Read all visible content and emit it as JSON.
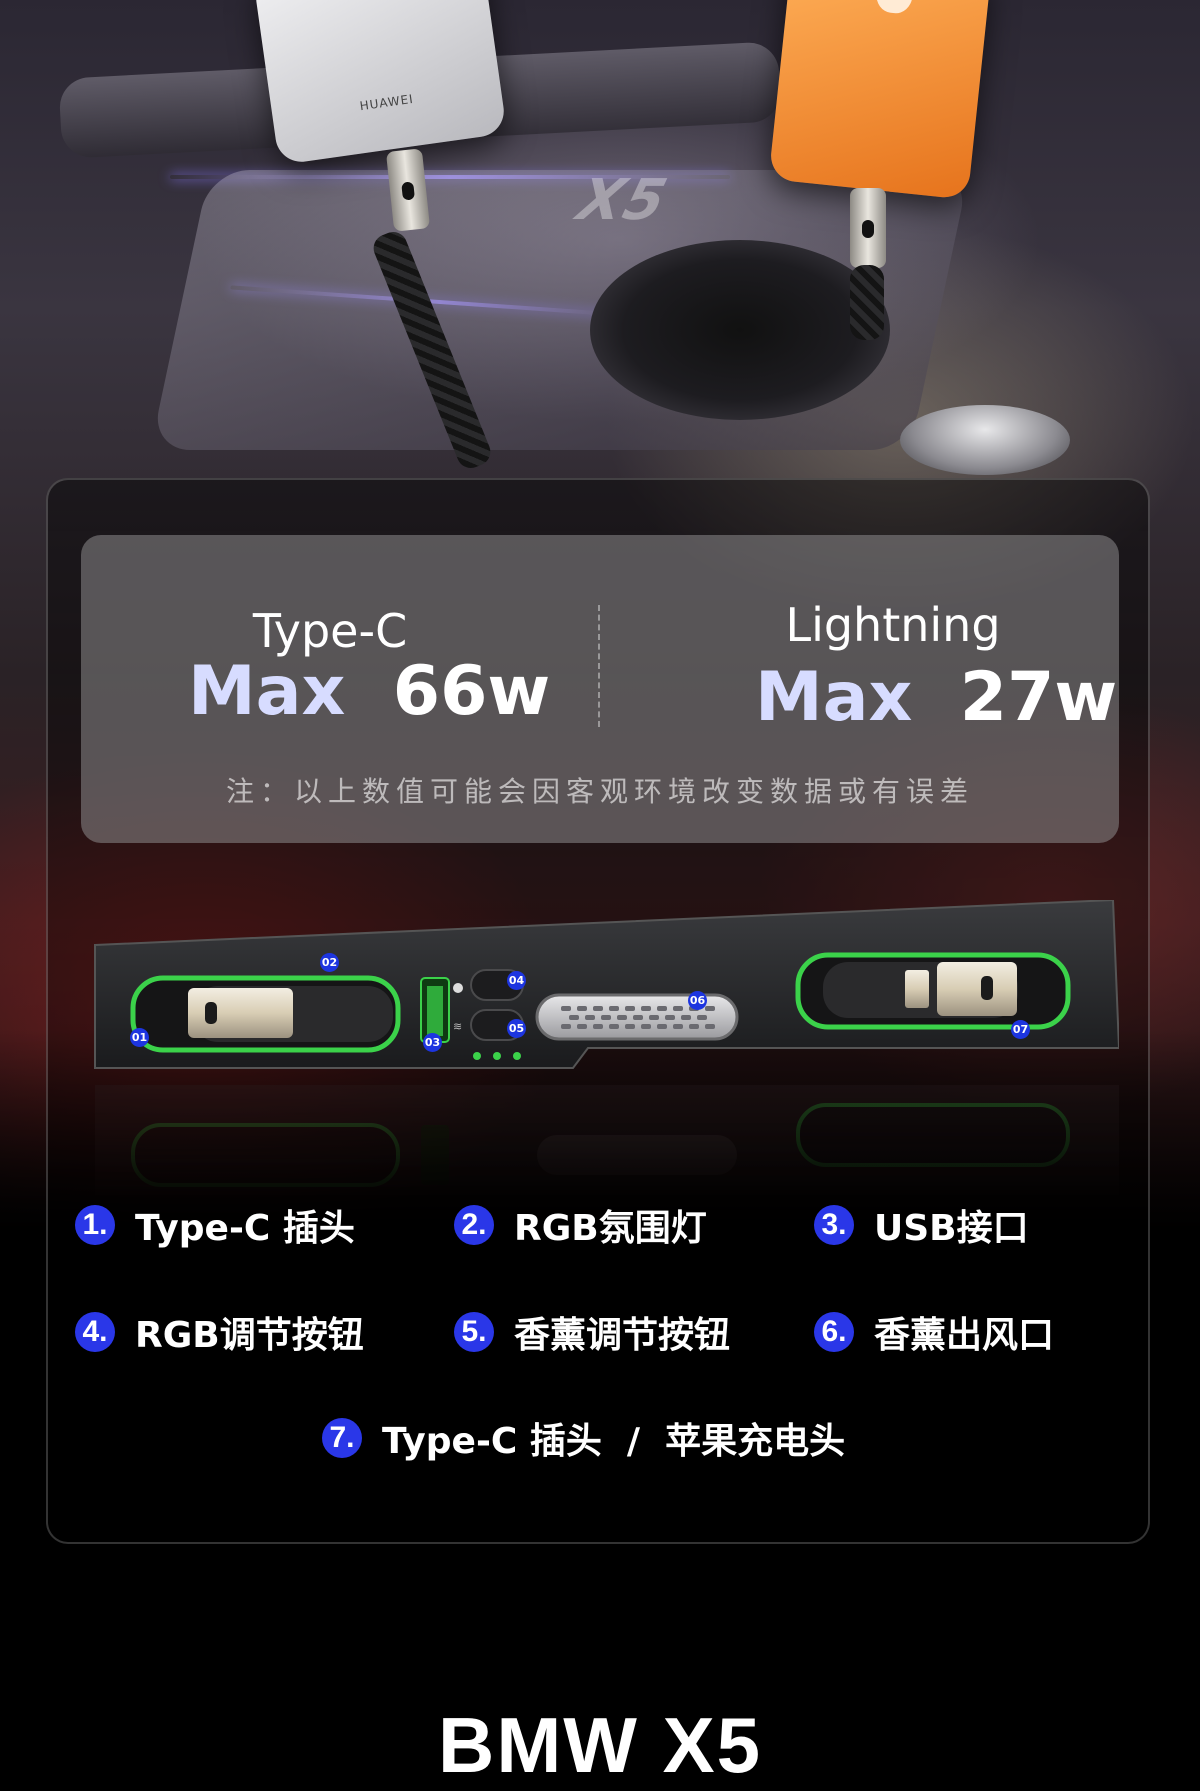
{
  "hero": {
    "huawei_brand": "HUAWEI",
    "x5_emboss": "X5"
  },
  "specs": {
    "left": {
      "name": "Type-C",
      "max_label": "Max",
      "watts": "66w"
    },
    "right": {
      "name": "Lightning",
      "max_label": "Max",
      "watts": "27w"
    },
    "note": "注：以上数值可能会因客观环境改变数据或有误差"
  },
  "ports": [
    {
      "id": "01"
    },
    {
      "id": "02"
    },
    {
      "id": "03"
    },
    {
      "id": "04"
    },
    {
      "id": "05"
    },
    {
      "id": "06"
    },
    {
      "id": "07"
    }
  ],
  "features": [
    {
      "num": "1.",
      "label": "Type-C 插头"
    },
    {
      "num": "2.",
      "label": "RGB氛围灯"
    },
    {
      "num": "3.",
      "label": "USB接口"
    },
    {
      "num": "4.",
      "label": "RGB调节按钮"
    },
    {
      "num": "5.",
      "label": "香薰调节按钮"
    },
    {
      "num": "6.",
      "label": "香薰出风口"
    },
    {
      "num": "7.",
      "label": "Type-C 插头  /  苹果充电头"
    }
  ],
  "footer": {
    "title": "BMW X5"
  },
  "colors": {
    "accent_blue": "#2a37e8",
    "charger_green": "#3bd24a",
    "panel_gray": "#8c8a8c"
  }
}
